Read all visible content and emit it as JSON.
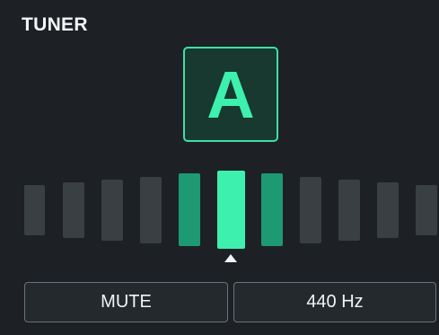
{
  "header": {
    "title": "TUNER"
  },
  "note": {
    "name": "A"
  },
  "meter": {
    "segment_count": 11,
    "active_segment": 5,
    "colors": {
      "inactive": "#3a3f44",
      "near": "#1e9a72",
      "center": "#3ef0ad"
    }
  },
  "buttons": {
    "mute_label": "MUTE",
    "reference_label": "440 Hz"
  },
  "colors": {
    "background": "#1d2125",
    "accent": "#3ef0ad",
    "note_box_fill": "#17392f",
    "button_border": "#6c7278"
  }
}
